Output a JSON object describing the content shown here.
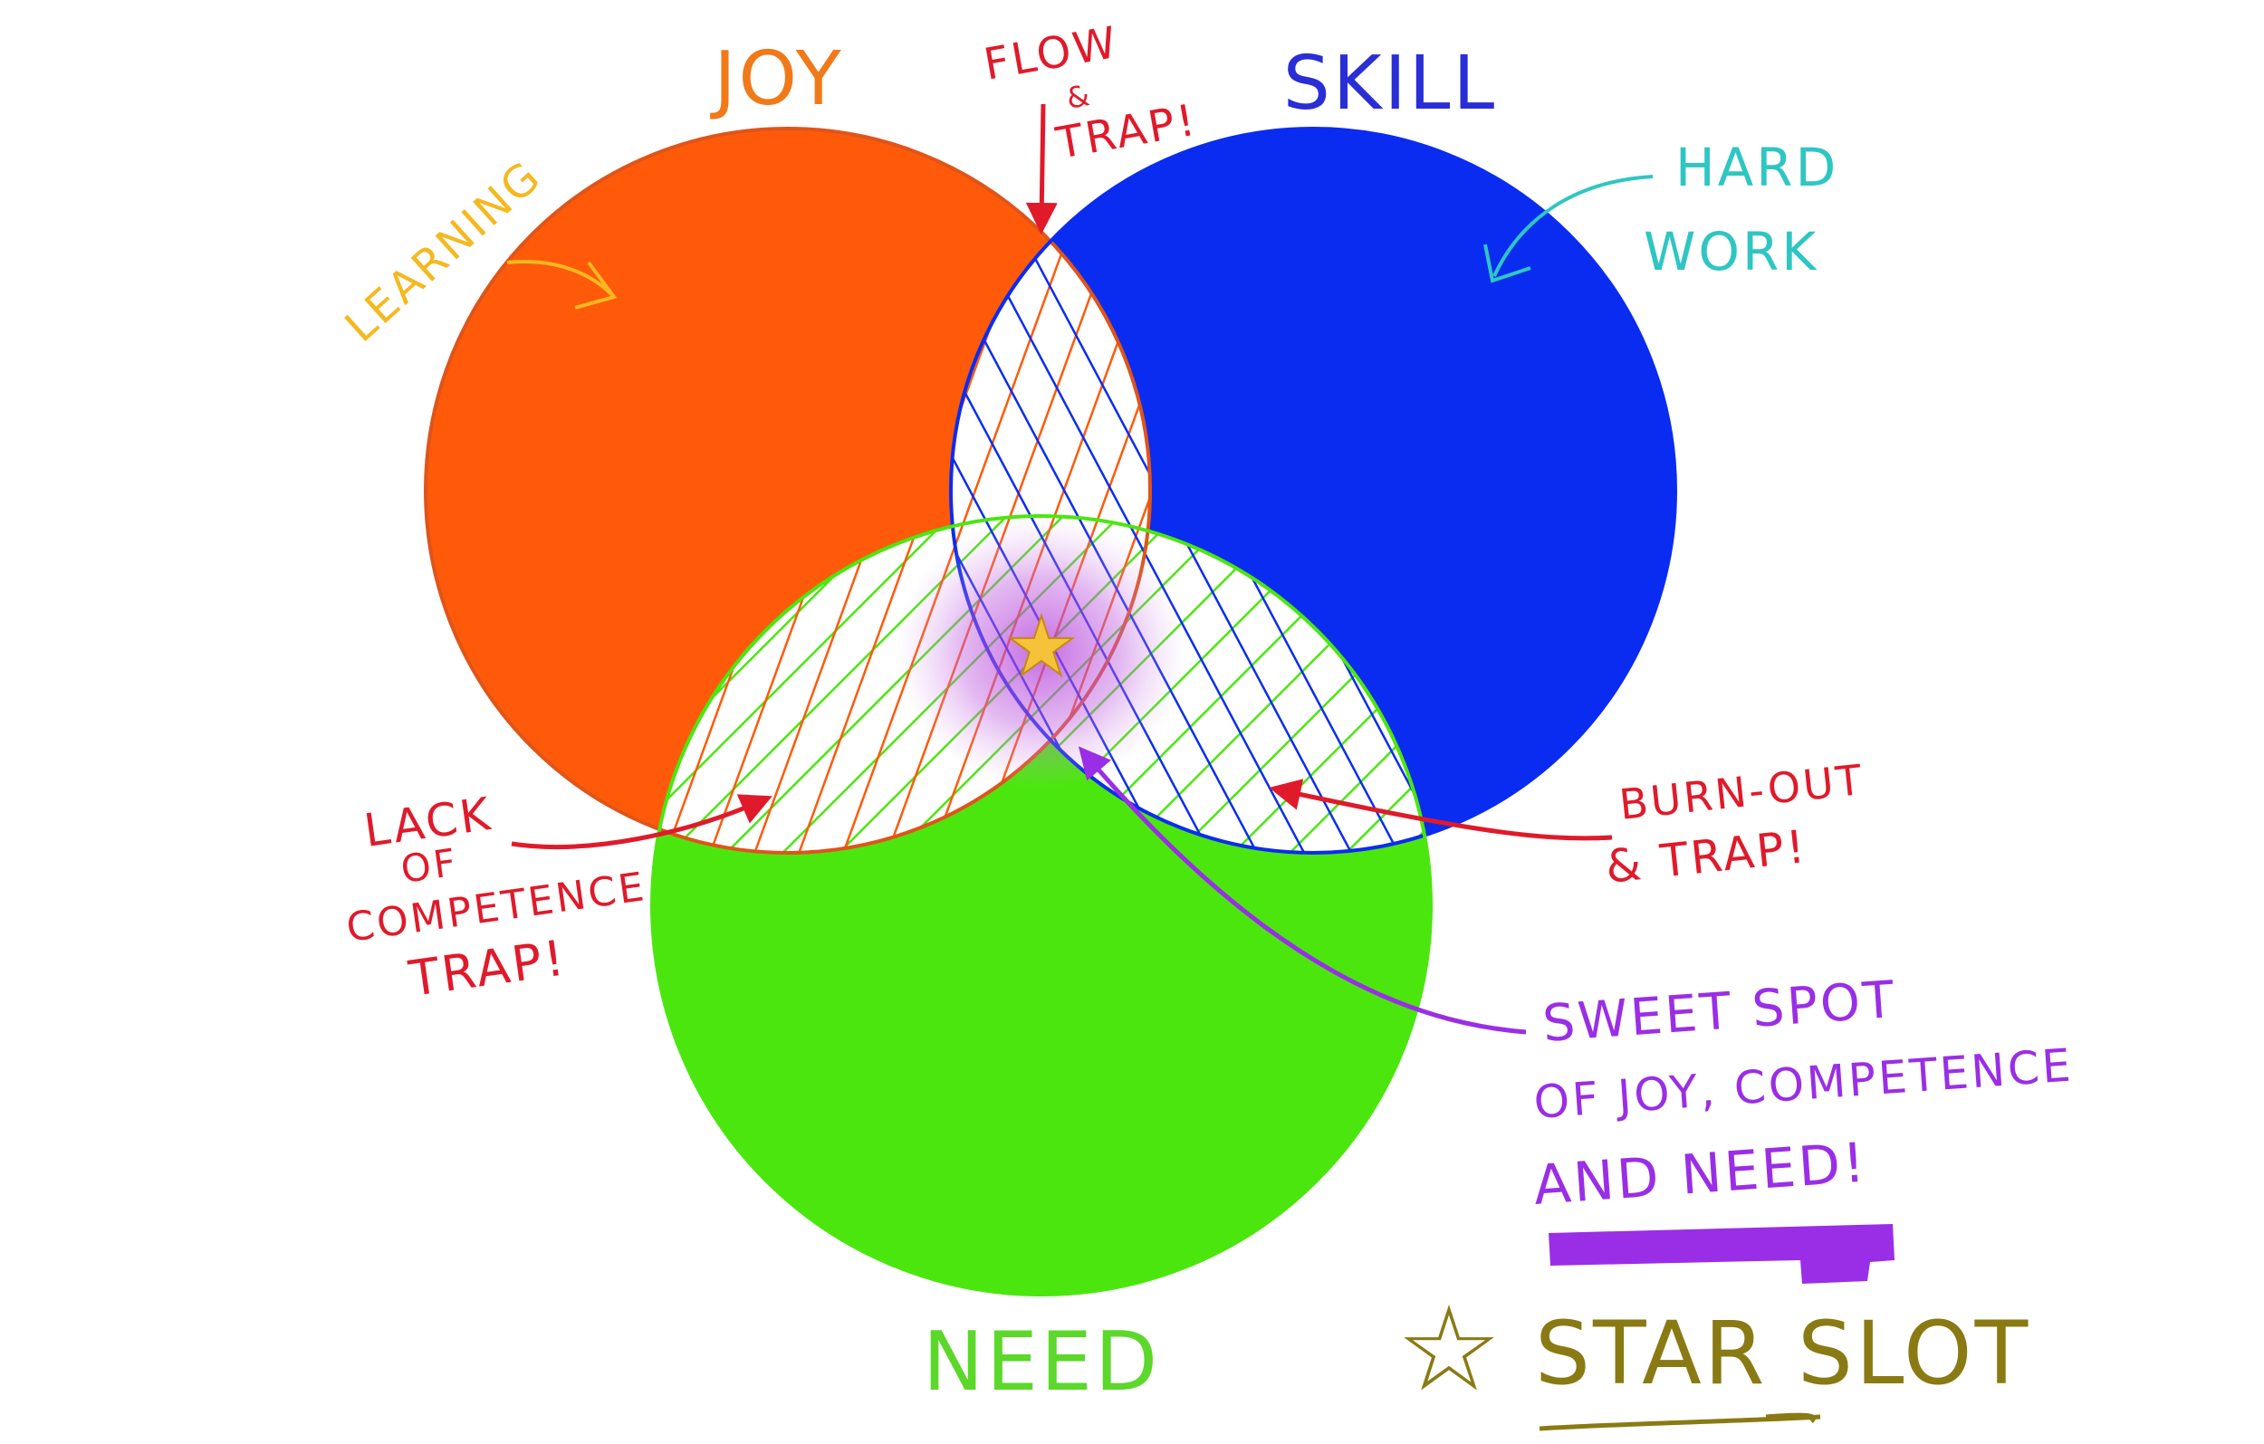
{
  "circles": {
    "joy": {
      "label": "JOY",
      "fill": "#ff5a0a",
      "label_color": "#f07a1a"
    },
    "skill": {
      "label": "SKILL",
      "fill": "#0a2cf0",
      "label_color": "#2a2ed6"
    },
    "need": {
      "label": "NEED",
      "fill": "#4ce60f",
      "label_color": "#5bd82a"
    }
  },
  "annotations": {
    "learning": {
      "text": "LEARNING",
      "color": "#f5b820"
    },
    "hard_work": {
      "lines": [
        "HARD",
        "WORK"
      ],
      "color": "#2ec6c2"
    },
    "flow_trap": {
      "lines": [
        "FLOW",
        "&",
        "TRAP!"
      ],
      "color": "#e01a2a"
    },
    "lack_of_competence": {
      "lines": [
        "LACK",
        "OF",
        "COMPETENCE",
        "TRAP!"
      ],
      "color": "#e01a2a"
    },
    "burn_out": {
      "lines": [
        "BURN-OUT",
        "& TRAP!"
      ],
      "color": "#e01a2a"
    },
    "sweet_spot": {
      "lines": [
        "SWEET SPOT",
        "OF JOY, COMPETENCE",
        "AND NEED!"
      ],
      "color": "#9a2ee6"
    },
    "star_slot": {
      "text": "STAR SLOT",
      "star": "☆",
      "color": "#8a7a14"
    }
  },
  "center_star": {
    "glyph": "★",
    "color": "#f5c23a"
  }
}
